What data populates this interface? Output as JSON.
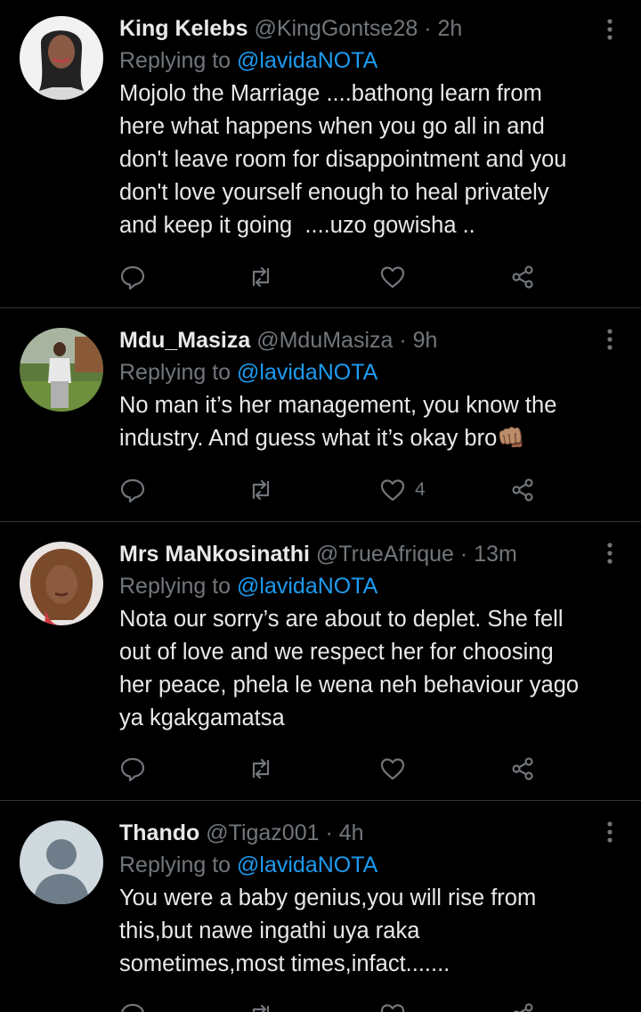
{
  "tweets": [
    {
      "name": "King Kelebs",
      "handle": "@KingGontse28",
      "separator": "·",
      "time": "2h",
      "replying_prefix": "Replying to",
      "replying_to": "@lavidaNOTA",
      "text": "Mojolo the Marriage ....bathong learn from\nhere what happens when you go all in and\ndon't leave room for disappointment and you\ndon't love yourself enough to heal privately\nand keep it going  ....uzo gowisha ..",
      "likes": ""
    },
    {
      "name": "Mdu_Masiza",
      "handle": "@MduMasiza",
      "separator": "·",
      "time": "9h",
      "replying_prefix": "Replying to",
      "replying_to": "@lavidaNOTA",
      "text": "No man it’s her management, you know the\nindustry. And guess what it’s okay bro👊🏽",
      "likes": "4"
    },
    {
      "name": "Mrs MaNkosinathi",
      "handle": "@TrueAfrique",
      "separator": "·",
      "time": "13m",
      "replying_prefix": "Replying to",
      "replying_to": "@lavidaNOTA",
      "text": "Nota our sorry’s are about to deplet. She fell\nout of love and we respect her for choosing\nher peace, phela le wena neh behaviour yago\nya kgakgamatsa",
      "likes": ""
    },
    {
      "name": "Thando",
      "handle": "@Tigaz001",
      "separator": "·",
      "time": "4h",
      "replying_prefix": "Replying to",
      "replying_to": "@lavidaNOTA",
      "text": "You were a baby genius,you will rise from\nthis,but nawe ingathi uya raka\nsometimes,most times,infact.......",
      "likes": ""
    }
  ],
  "icons": {
    "reply": "reply-icon",
    "retweet": "retweet-icon",
    "like": "heart-icon",
    "share": "share-icon",
    "more": "more-vertical-icon",
    "default_avatar": "default-avatar-icon"
  },
  "colors": {
    "background": "#000000",
    "text": "#e7e9ea",
    "secondary": "#71767b",
    "link": "#1d9bf0",
    "divider": "#2f3336"
  }
}
